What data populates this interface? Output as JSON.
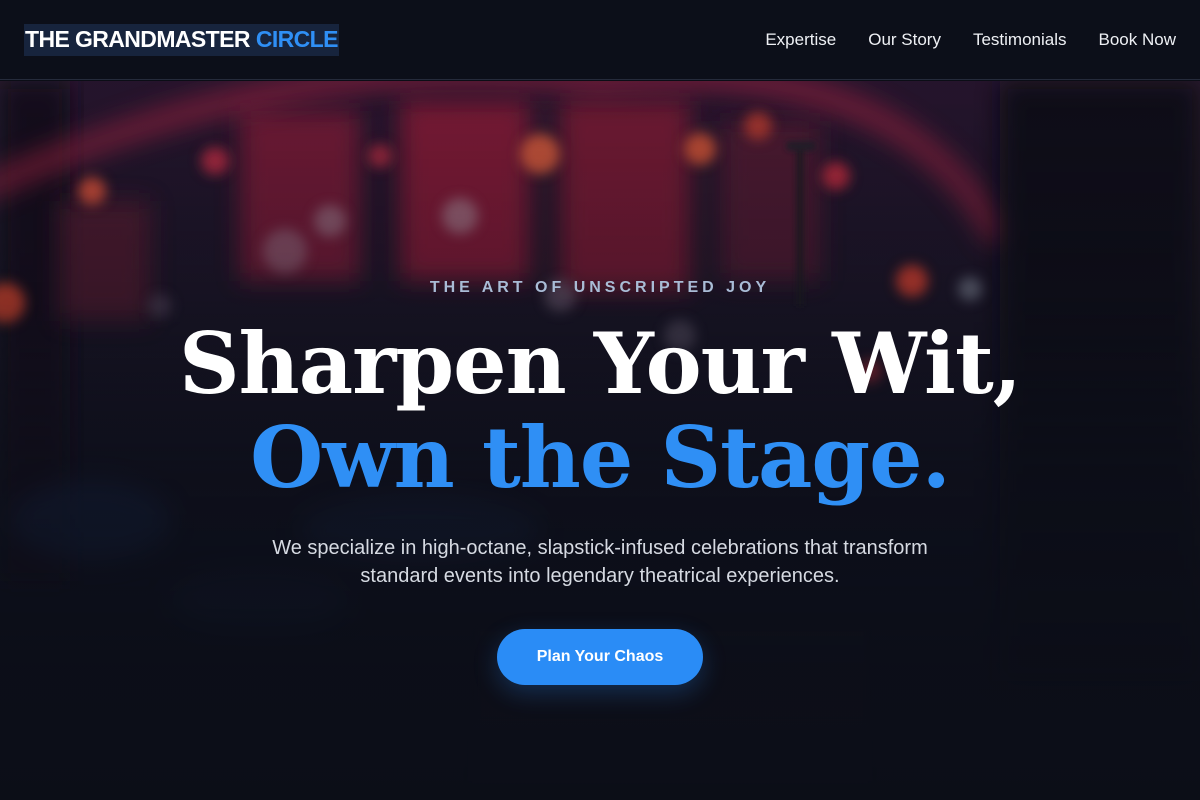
{
  "brand": {
    "name_part1": "THE GRANDMASTER",
    "name_part2": "CIRCLE",
    "accent_color": "#2f8ff5"
  },
  "nav": {
    "items": [
      {
        "label": "Expertise"
      },
      {
        "label": "Our Story"
      },
      {
        "label": "Testimonials"
      },
      {
        "label": "Book Now"
      }
    ]
  },
  "hero": {
    "eyebrow": "THE ART OF UNSCRIPTED JOY",
    "headline_line1": "Sharpen Your Wit,",
    "headline_line2": "Own the Stage.",
    "subtext": "We specialize in high-octane, slapstick-infused celebrations that transform standard events into legendary theatrical experiences.",
    "cta_label": "Plan Your Chaos",
    "background_image": "blurred-stage-lights-photo"
  }
}
